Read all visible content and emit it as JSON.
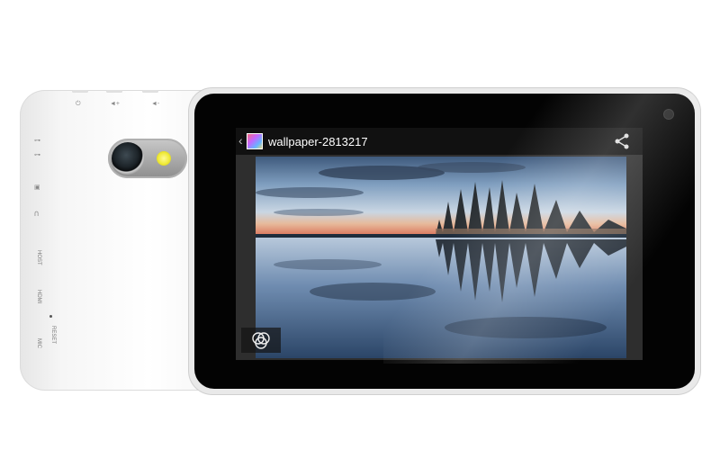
{
  "screen": {
    "title": "wallpaper-2813217"
  },
  "back_labels": {
    "host": "HOST",
    "hdmi": "HDMI",
    "reset": "RESET",
    "mic": "MIC"
  },
  "icons": {
    "back": "chevron-left-icon",
    "app": "gallery-app-icon",
    "share": "share-icon",
    "filters": "photo-filters-icon"
  },
  "colors": {
    "bezel": "#030303",
    "action_bar": "#111111",
    "body_white": "#f4f4f4",
    "flash": "#f0ea3a"
  }
}
